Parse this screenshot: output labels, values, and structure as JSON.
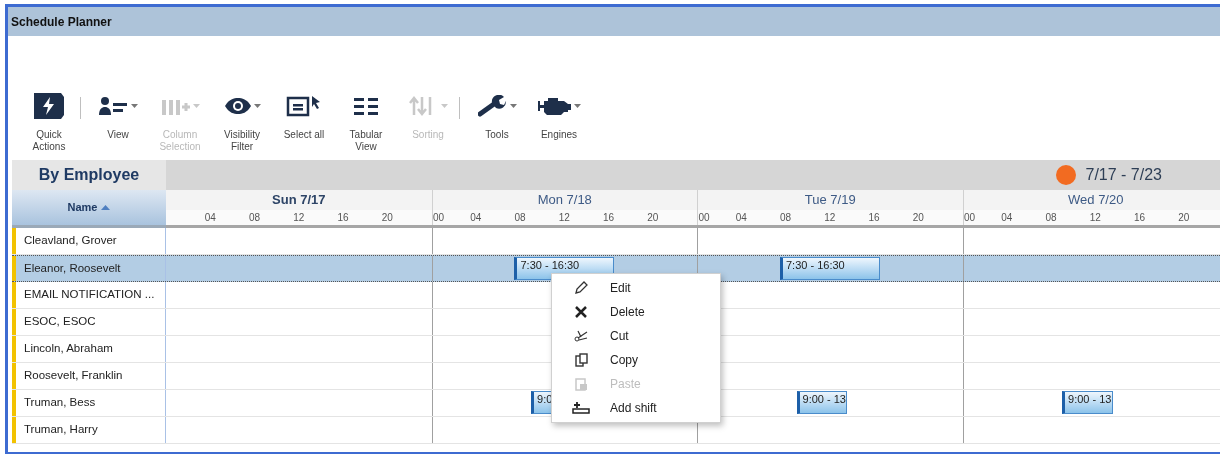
{
  "window": {
    "title": "Schedule Planner"
  },
  "toolbar": [
    {
      "kind": "quick",
      "label": "Quick Actions",
      "dropdown": false,
      "disabled": false,
      "separator_before": false
    },
    {
      "kind": "view",
      "label": "View",
      "dropdown": true,
      "disabled": false,
      "separator_before": true
    },
    {
      "kind": "columns",
      "label": "Column Selection",
      "dropdown": true,
      "disabled": true,
      "separator_before": false
    },
    {
      "kind": "eye",
      "label": "Visibility Filter",
      "dropdown": true,
      "disabled": false,
      "separator_before": false
    },
    {
      "kind": "select",
      "label": "Select all",
      "dropdown": false,
      "disabled": false,
      "separator_before": false
    },
    {
      "kind": "tabular",
      "label": "Tabular View",
      "dropdown": false,
      "disabled": false,
      "separator_before": false
    },
    {
      "kind": "sort",
      "label": "Sorting",
      "dropdown": true,
      "disabled": true,
      "separator_before": false
    },
    {
      "kind": "tools",
      "label": "Tools",
      "dropdown": true,
      "disabled": false,
      "separator_before": true
    },
    {
      "kind": "engine",
      "label": "Engines",
      "dropdown": true,
      "disabled": false,
      "separator_before": false
    }
  ],
  "grid": {
    "title": "By Employee",
    "name_column": "Name",
    "date_range": "7/17 - 7/23",
    "days": [
      {
        "label": "Sun 7/17",
        "selected": true,
        "ticks": [
          "04",
          "08",
          "12",
          "16",
          "20"
        ]
      },
      {
        "label": "Mon 7/18",
        "selected": false,
        "ticks": [
          "00",
          "04",
          "08",
          "12",
          "16",
          "20"
        ]
      },
      {
        "label": "Tue 7/19",
        "selected": false,
        "ticks": [
          "00",
          "04",
          "08",
          "12",
          "16",
          "20"
        ]
      },
      {
        "label": "Wed 7/20",
        "selected": false,
        "ticks": [
          "00",
          "04",
          "08",
          "12",
          "16",
          "20"
        ]
      }
    ],
    "rows": [
      {
        "name": "Cleavland, Grover",
        "selected": false,
        "shifts": []
      },
      {
        "name": "Eleanor, Roosevelt",
        "selected": true,
        "shifts": [
          {
            "label": "7:30 - 16:30"
          },
          {
            "label": "7:30 - 16:30"
          }
        ]
      },
      {
        "name": "EMAIL NOTIFICATION ...",
        "selected": false,
        "shifts": []
      },
      {
        "name": "ESOC, ESOC",
        "selected": false,
        "shifts": []
      },
      {
        "name": "Lincoln, Abraham",
        "selected": false,
        "shifts": []
      },
      {
        "name": "Roosevelt, Franklin",
        "selected": false,
        "shifts": []
      },
      {
        "name": "Truman, Bess",
        "selected": false,
        "shifts": [
          {
            "label": "9:0"
          },
          {
            "label": "9:00 - 13"
          },
          {
            "label": "9:00 - 13"
          }
        ]
      },
      {
        "name": "Truman, Harry",
        "selected": false,
        "shifts": []
      }
    ]
  },
  "context_menu": [
    {
      "kind": "edit",
      "label": "Edit",
      "disabled": false
    },
    {
      "kind": "delete",
      "label": "Delete",
      "disabled": false
    },
    {
      "kind": "cut",
      "label": "Cut",
      "disabled": false
    },
    {
      "kind": "copy",
      "label": "Copy",
      "disabled": false
    },
    {
      "kind": "paste",
      "label": "Paste",
      "disabled": true
    },
    {
      "kind": "add",
      "label": "Add shift",
      "disabled": false
    }
  ]
}
